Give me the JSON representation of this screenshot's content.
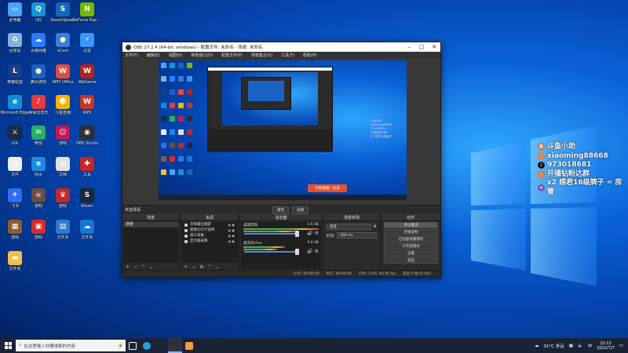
{
  "desktop_icons": [
    {
      "label": "此电脑",
      "color": "#4aa3ff",
      "glyph": "▭"
    },
    {
      "label": "QQ",
      "color": "#1296db",
      "glyph": "Q"
    },
    {
      "label": "SteamSpeed",
      "color": "#0e6ab8",
      "glyph": "S"
    },
    {
      "label": "GeForce Experience",
      "color": "#76b900",
      "glyph": "N"
    },
    {
      "label": "回收站",
      "color": "#7fb2d9",
      "glyph": "♻"
    },
    {
      "label": "百度网盘",
      "color": "#2b7dff",
      "glyph": "☁"
    },
    {
      "label": "oCam",
      "color": "#3b7bd9",
      "glyph": "●"
    },
    {
      "label": "迅雷",
      "color": "#3498ff",
      "glyph": "⚡"
    },
    {
      "label": "英雄联盟",
      "color": "#1a3b8c",
      "glyph": "L"
    },
    {
      "label": "腾讯游戏",
      "color": "#1f5fbf",
      "glyph": "●"
    },
    {
      "label": "WPS Office",
      "color": "#e44b3b",
      "glyph": "W"
    },
    {
      "label": "WeGame",
      "color": "#b22222",
      "glyph": "W"
    },
    {
      "label": "Microsoft Edge",
      "color": "#0f8fd6",
      "glyph": "e"
    },
    {
      "label": "网易云音乐",
      "color": "#e23b3b",
      "glyph": "♪"
    },
    {
      "label": "斗鱼直播",
      "color": "#f7b500",
      "glyph": "☻"
    },
    {
      "label": "WPS",
      "color": "#c0392b",
      "glyph": "W"
    },
    {
      "label": "LOL",
      "color": "#1c2c40",
      "glyph": "⚔"
    },
    {
      "label": "微信",
      "color": "#2aae67",
      "glyph": "✉"
    },
    {
      "label": "游戏",
      "color": "#c2185b",
      "glyph": "☺"
    },
    {
      "label": "OBS Studio",
      "color": "#302e31",
      "glyph": "◉"
    },
    {
      "label": "文件",
      "color": "#e9eef5",
      "glyph": "▤"
    },
    {
      "label": "网页",
      "color": "#1e88e5",
      "glyph": "e"
    },
    {
      "label": "文档",
      "color": "#e0e0e0",
      "glyph": "▤"
    },
    {
      "label": "工具",
      "color": "#c62828",
      "glyph": "✚"
    },
    {
      "label": "飞书",
      "color": "#2f6df5",
      "glyph": "✈"
    },
    {
      "label": "游戏",
      "color": "#6d4c41",
      "glyph": "☠"
    },
    {
      "label": "游戏",
      "color": "#c62828",
      "glyph": "♛"
    },
    {
      "label": "Steam",
      "color": "#1b2838",
      "glyph": "S"
    },
    {
      "label": "游戏",
      "color": "#8e5c2a",
      "glyph": "▦"
    },
    {
      "label": "游戏",
      "color": "#d32f2f",
      "glyph": "▣"
    },
    {
      "label": "文件夹",
      "color": "#2e7bcf",
      "glyph": "▤"
    },
    {
      "label": "文件夹",
      "color": "#1976d2",
      "glyph": "☁"
    },
    {
      "label": "文件夹",
      "color": "#f3c04a",
      "glyph": "▬"
    }
  ],
  "obs": {
    "title": "OBS 27.2.4 (64-bit, windows) - 配置文件: 未命名 - 场景: 未命名",
    "menu": [
      "文件(F)",
      "编辑(E)",
      "视图(V)",
      "停靠窗口(D)",
      "配置文件(P)",
      "场景集合(S)",
      "工具(T)",
      "帮助(H)"
    ],
    "preview_banner": "开始直播，拉流",
    "preview_overlay": [
      "斗鱼小助",
      "xiaoming88668",
      "973018681",
      "开播钻粉达群",
      "x2 感君16级牌子"
    ],
    "scene_label": "未选择源",
    "scene_buttons": [
      "属性",
      "滤镜"
    ],
    "docks": {
      "scenes": {
        "header": "场景",
        "items": [
          "场景"
        ]
      },
      "sources": {
        "header": "来源",
        "items": [
          "音频输出捕获",
          "图像幻灯片放映",
          "窗口采集",
          "显示器采集"
        ]
      },
      "mixer": {
        "header": "混音器",
        "tracks": [
          {
            "name": "桌面音频",
            "db": "-1.6 dB"
          },
          {
            "name": "麦克风/Aux",
            "db": "0.0 dB"
          }
        ]
      },
      "transitions": {
        "header": "场景转场",
        "type": "渐变",
        "duration_label": "时长",
        "duration_value": "300 ms"
      },
      "controls": {
        "header": "控件",
        "buttons": [
          "停止推流",
          "开始录制",
          "启动虚拟摄像机",
          "工作室模式",
          "设置",
          "退出"
        ]
      }
    },
    "status": {
      "live_label": "LIVE:",
      "live_time": "00:00:00",
      "rec_label": "REC:",
      "rec_time": "00:00:00",
      "cpu": "CPU: 3.4%, 60.00 fps",
      "dropped": "延迟 0 帧 (0.0%)"
    }
  },
  "danmaku": [
    {
      "icon": "鱼",
      "text": "斗鱼小助"
    },
    {
      "icon": "◎",
      "text": "xiaoming88668"
    },
    {
      "icon": "♪",
      "text": "973018681"
    },
    {
      "icon": "◎",
      "text": "开播钻粉达群"
    },
    {
      "icon": "★",
      "text": "x2 感君16级牌子 = 房管"
    }
  ],
  "taskbar": {
    "search_placeholder": "在这里输入你要搜索的内容",
    "weather": "31°C 多云",
    "time": "22:12",
    "date": "2022/7/7",
    "lang": "中"
  }
}
